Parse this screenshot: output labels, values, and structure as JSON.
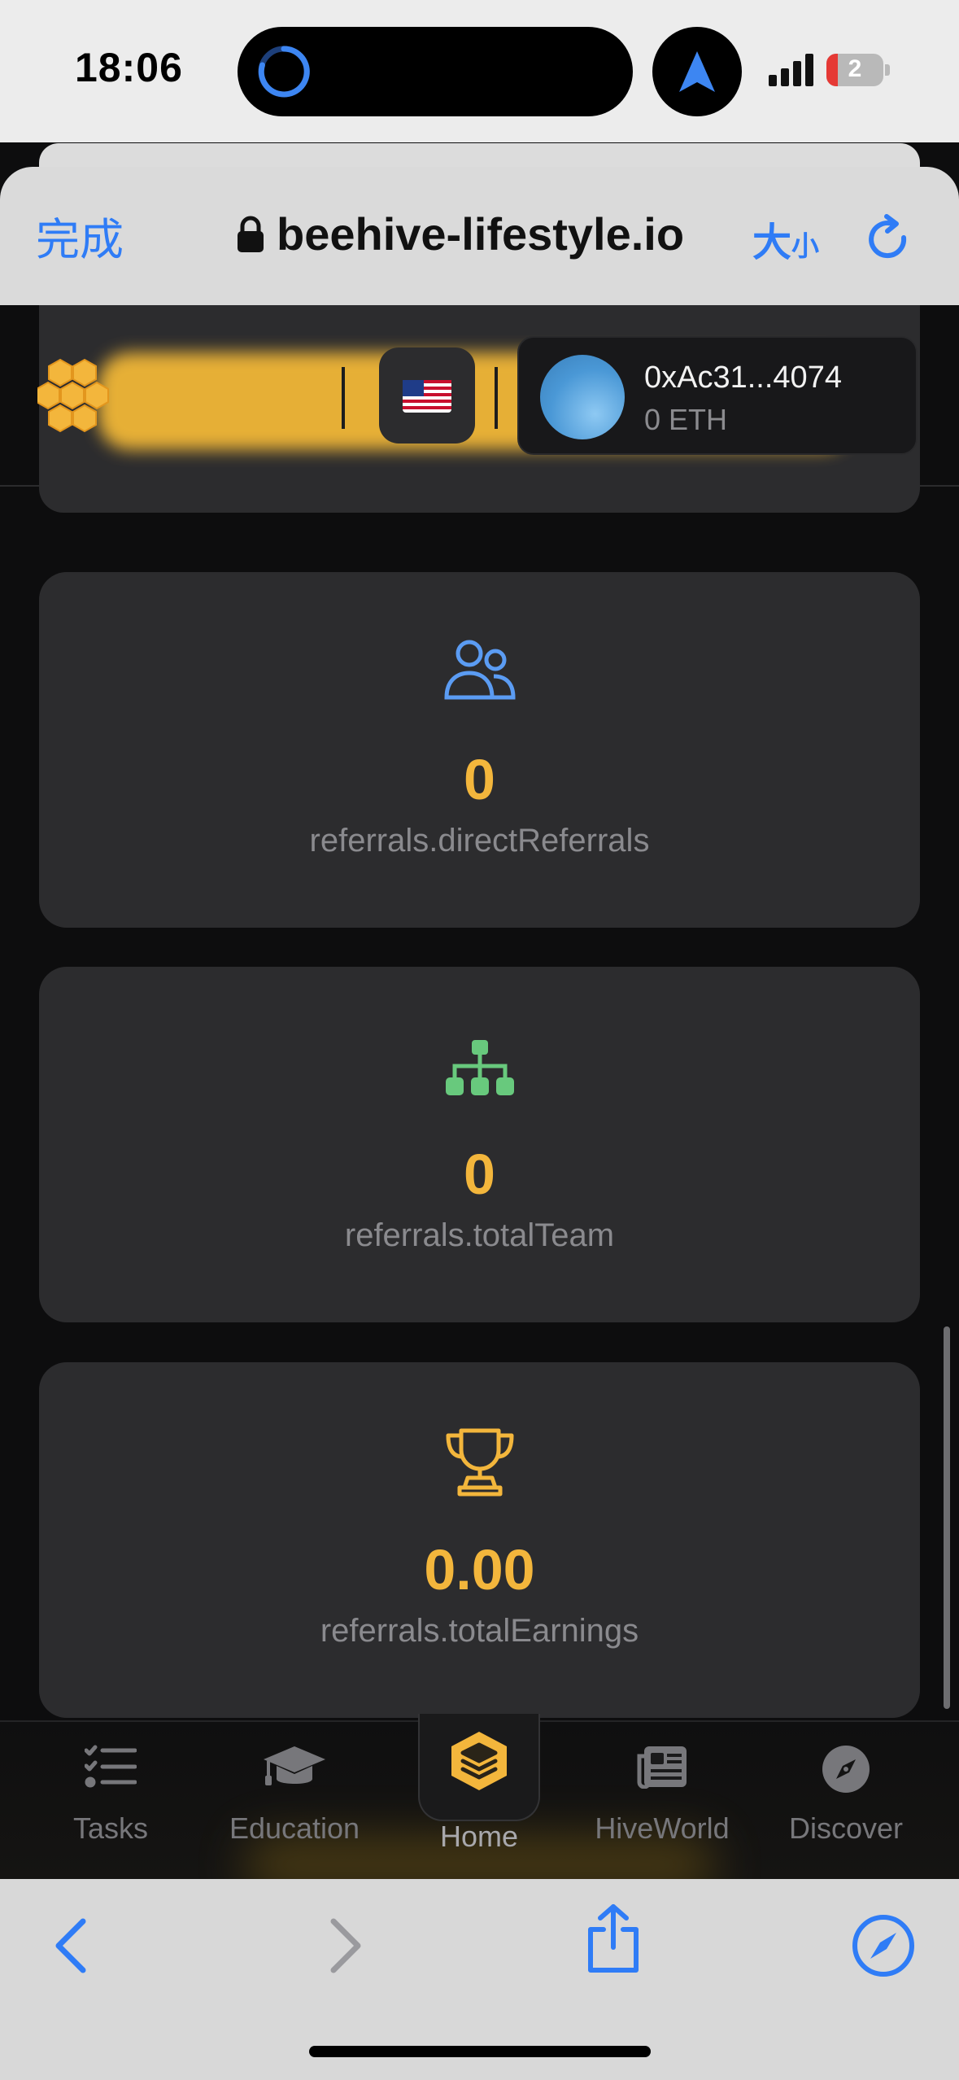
{
  "status_bar": {
    "time": "18:06",
    "battery_level": "2",
    "battery_fraction": 0.2
  },
  "browser": {
    "done_label": "完成",
    "url": "beehive-lifestyle.io",
    "size_label_big": "大",
    "size_label_small": "小",
    "accent_color": "#2f7cf6"
  },
  "header": {
    "wallet_address": "0xAc31...4074",
    "wallet_balance": "0 ETH",
    "language_flag": "us-flag-icon",
    "brand_color": "#f3b63c"
  },
  "stats": [
    {
      "icon": "users-icon",
      "value": "0",
      "label": "referrals.directReferrals"
    },
    {
      "icon": "org-chart-icon",
      "value": "0",
      "label": "referrals.totalTeam"
    },
    {
      "icon": "trophy-icon",
      "value": "0.00",
      "label": "referrals.totalEarnings"
    }
  ],
  "bottom_nav": {
    "items": [
      {
        "label": "Tasks",
        "icon": "tasks-icon"
      },
      {
        "label": "Education",
        "icon": "graduation-cap-icon"
      },
      {
        "label": "Home",
        "icon": "layers-hexagon-icon",
        "active": true
      },
      {
        "label": "HiveWorld",
        "icon": "newspaper-icon"
      },
      {
        "label": "Discover",
        "icon": "compass-icon"
      }
    ]
  }
}
